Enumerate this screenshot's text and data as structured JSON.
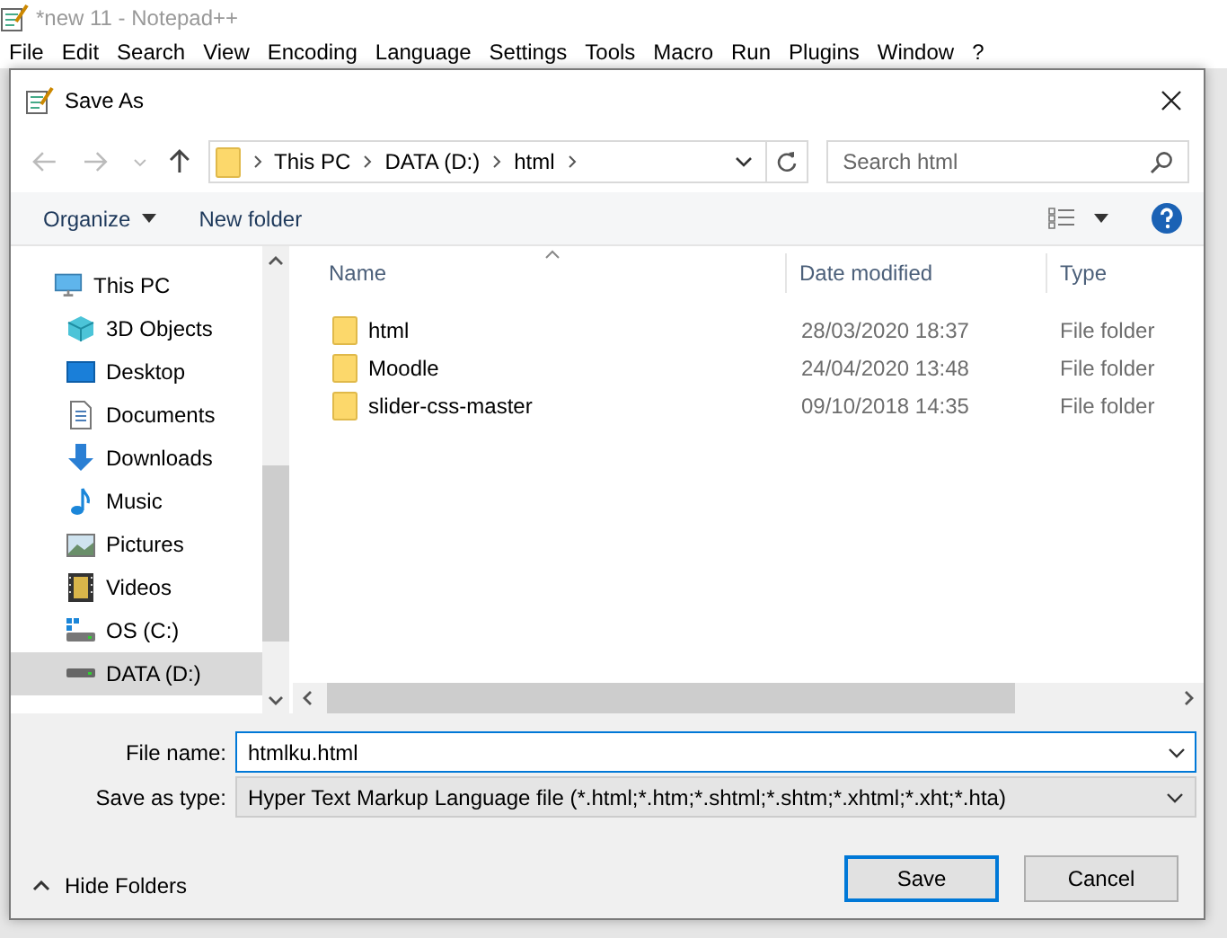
{
  "app": {
    "title": "*new 11 - Notepad++",
    "menu": [
      "File",
      "Edit",
      "Search",
      "View",
      "Encoding",
      "Language",
      "Settings",
      "Tools",
      "Macro",
      "Run",
      "Plugins",
      "Window",
      "?"
    ]
  },
  "dialog": {
    "title": "Save As",
    "address": [
      "This PC",
      "DATA (D:)",
      "html"
    ],
    "search": {
      "placeholder": "Search html"
    },
    "toolbar": {
      "organize": "Organize",
      "new_folder": "New folder"
    },
    "tree": [
      {
        "label": "This PC",
        "kind": "pc",
        "selected": false,
        "children": [
          {
            "label": "3D Objects",
            "kind": "cube",
            "selected": false
          },
          {
            "label": "Desktop",
            "kind": "desktop",
            "selected": false
          },
          {
            "label": "Documents",
            "kind": "documents",
            "selected": false
          },
          {
            "label": "Downloads",
            "kind": "downloads",
            "selected": false
          },
          {
            "label": "Music",
            "kind": "music",
            "selected": false
          },
          {
            "label": "Pictures",
            "kind": "pictures",
            "selected": false
          },
          {
            "label": "Videos",
            "kind": "videos",
            "selected": false
          },
          {
            "label": "OS (C:)",
            "kind": "osdrive",
            "selected": false
          },
          {
            "label": "DATA (D:)",
            "kind": "drive",
            "selected": true
          }
        ]
      }
    ],
    "columns": [
      "Name",
      "Date modified",
      "Type"
    ],
    "files": [
      {
        "name": "html",
        "date": "28/03/2020 18:37",
        "type": "File folder"
      },
      {
        "name": "Moodle",
        "date": "24/04/2020 13:48",
        "type": "File folder"
      },
      {
        "name": "slider-css-master",
        "date": "09/10/2018 14:35",
        "type": "File folder"
      }
    ],
    "file_name": {
      "label": "File name:",
      "value": "htmlku.html"
    },
    "save_type": {
      "label": "Save as type:",
      "value": "Hyper Text Markup Language file (*.html;*.htm;*.shtml;*.shtm;*.xhtml;*.xht;*.hta)"
    },
    "hide_folders": "Hide Folders",
    "buttons": [
      {
        "label": "Save",
        "default": true
      },
      {
        "label": "Cancel",
        "default": false
      }
    ]
  }
}
